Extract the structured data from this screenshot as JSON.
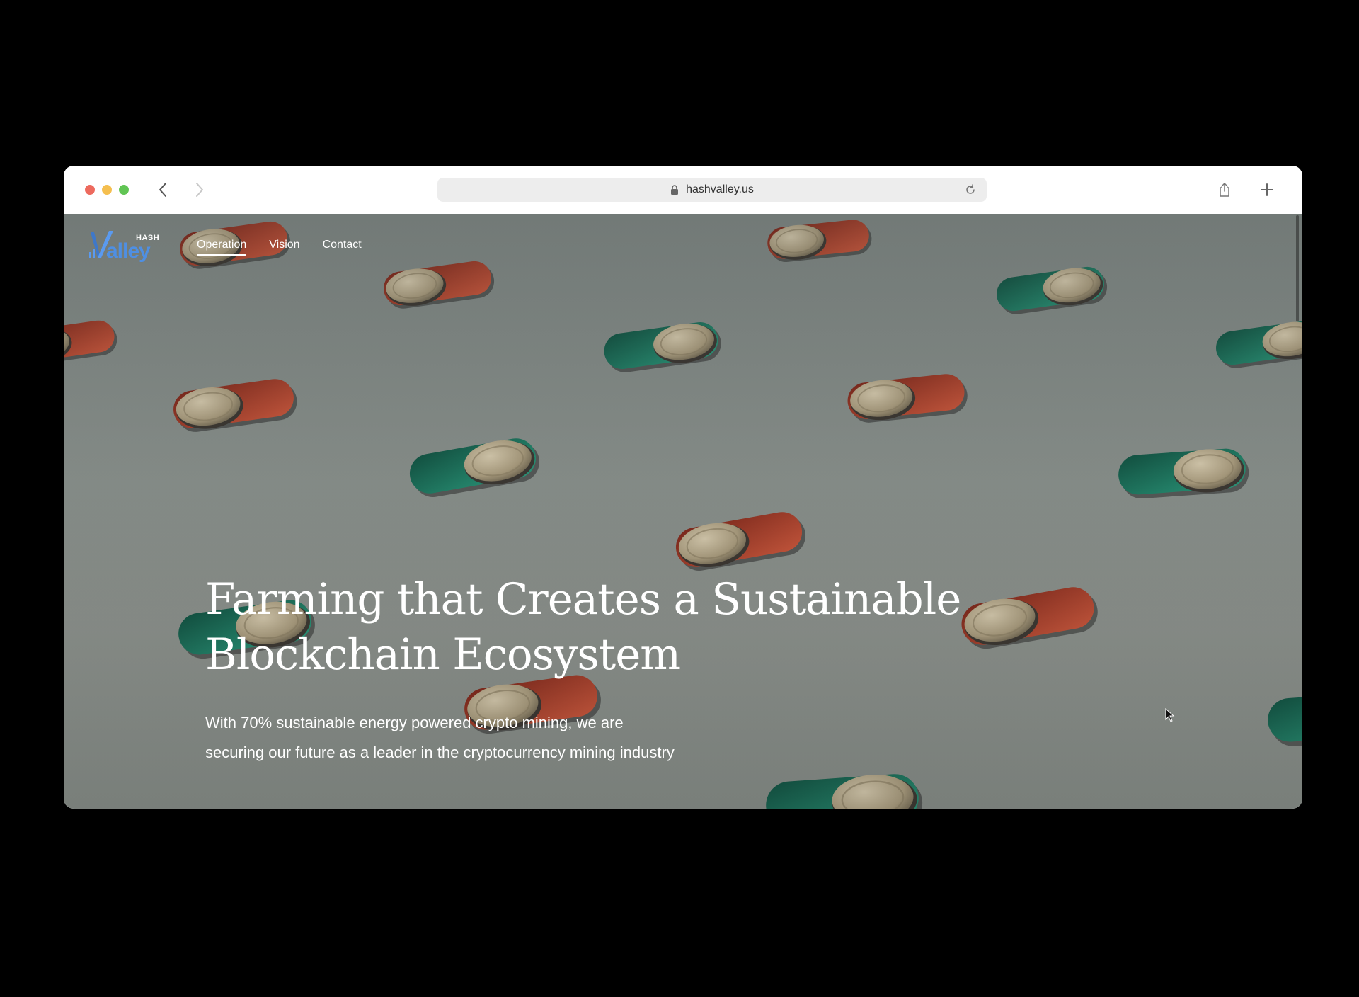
{
  "browser": {
    "url": "hashvalley.us",
    "icons": {
      "back": "chevron-left-icon",
      "forward": "chevron-right-icon",
      "lock": "lock-icon",
      "reload": "reload-icon",
      "share": "share-icon",
      "new_tab": "plus-icon"
    }
  },
  "site": {
    "logo": {
      "hash": "HASH",
      "valley": "alley"
    },
    "nav": [
      {
        "label": "Operation",
        "active": true
      },
      {
        "label": "Vision",
        "active": false
      },
      {
        "label": "Contact",
        "active": false
      }
    ]
  },
  "hero": {
    "title_line1": "Farming that Creates a Sustainable",
    "title_line2": "Blockchain Ecosystem",
    "subtitle_line1": "With 70% sustainable energy powered crypto mining, we are",
    "subtitle_line2": "securing our future as a leader in the cryptocurrency mining industry"
  },
  "colors": {
    "accent_blue": "#4f8fe2",
    "coin_gold": "#b8a98a",
    "slot_red": "#b3452e",
    "slot_green": "#1d7a64"
  }
}
